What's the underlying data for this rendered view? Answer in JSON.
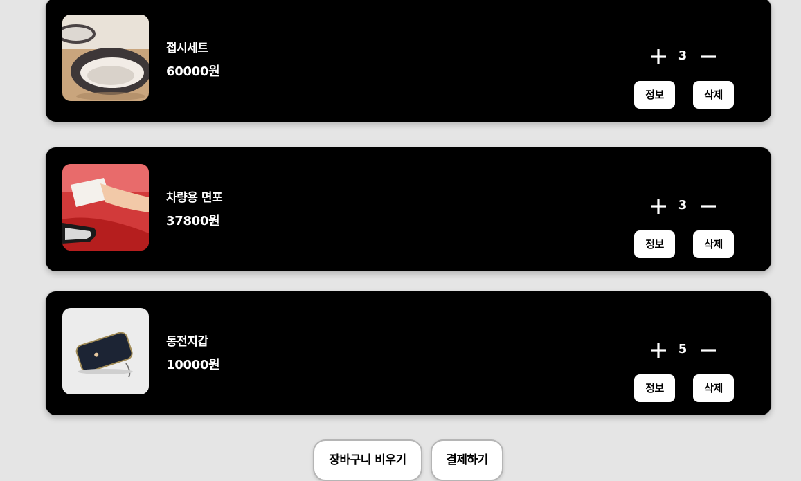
{
  "cart": {
    "items": [
      {
        "name": "접시세트",
        "price": "60000원",
        "quantity": "3",
        "info_label": "정보",
        "delete_label": "삭제",
        "image_icon": "colander-dish-icon"
      },
      {
        "name": "차량용 면포",
        "price": "37800원",
        "quantity": "3",
        "info_label": "정보",
        "delete_label": "삭제",
        "image_icon": "car-cloth-icon"
      },
      {
        "name": "동전지갑",
        "price": "10000원",
        "quantity": "5",
        "info_label": "정보",
        "delete_label": "삭제",
        "image_icon": "coin-wallet-icon"
      }
    ],
    "empty_label": "장바구니 비우기",
    "checkout_label": "결제하기"
  },
  "colors": {
    "background": "#e5e5e5",
    "card": "#000000",
    "button": "#ffffff"
  }
}
